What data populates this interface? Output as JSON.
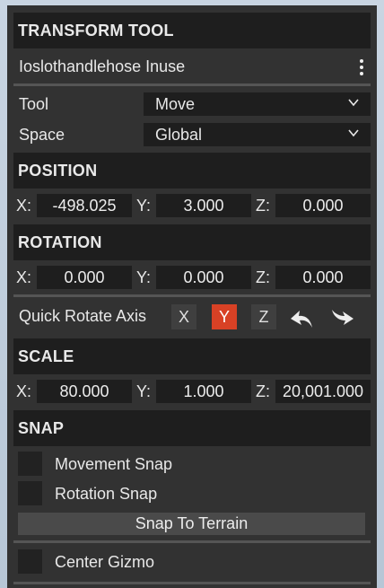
{
  "panel": {
    "title": "TRANSFORM TOOL",
    "object_name": "Ioslothandlehose Inuse"
  },
  "tool": {
    "label": "Tool",
    "value": "Move"
  },
  "space": {
    "label": "Space",
    "value": "Global"
  },
  "position": {
    "header": "POSITION",
    "x_label": "X:",
    "x": "-498.025",
    "y_label": "Y:",
    "y": "3.000",
    "z_label": "Z:",
    "z": "0.000"
  },
  "rotation": {
    "header": "ROTATION",
    "x_label": "X:",
    "x": "0.000",
    "y_label": "Y:",
    "y": "0.000",
    "z_label": "Z:",
    "z": "0.000"
  },
  "quick_rotate": {
    "label": "Quick Rotate Axis",
    "axes": [
      "X",
      "Y",
      "Z"
    ],
    "active_axis": "Y"
  },
  "scale": {
    "header": "SCALE",
    "x_label": "X:",
    "x": "80.000",
    "y_label": "Y:",
    "y": "1.000",
    "z_label": "Z:",
    "z": "20,001.000"
  },
  "snap": {
    "header": "SNAP",
    "movement_label": "Movement Snap",
    "movement_checked": false,
    "rotation_label": "Rotation Snap",
    "rotation_checked": false,
    "terrain_button": "Snap To Terrain"
  },
  "center_gizmo": {
    "label": "Center Gizmo",
    "checked": false
  },
  "colors": {
    "accent_active": "#d84125",
    "panel_bg": "#323232",
    "header_bg": "#1e1e1e"
  }
}
